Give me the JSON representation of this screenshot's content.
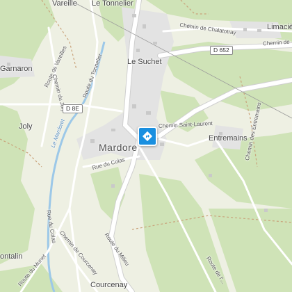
{
  "map": {
    "places": [
      {
        "name": "Vareille"
      },
      {
        "name": "Le Tonnelier"
      },
      {
        "name": "Limaciè"
      },
      {
        "name": "Le Suchet"
      },
      {
        "name": "Garnaron"
      },
      {
        "name": "Joly"
      },
      {
        "name": "Mardore"
      },
      {
        "name": "Entremains"
      },
      {
        "name": "ontalin"
      },
      {
        "name": "Courcenay"
      }
    ],
    "roads": [
      {
        "name": "Chemin de Chalatotray"
      },
      {
        "name": "Chemin de"
      },
      {
        "name": "Route de Vareilles"
      },
      {
        "name": "Route du Tonnelier"
      },
      {
        "name": "Chemin du Joly"
      },
      {
        "name": "Chemin Saint-Laurent"
      },
      {
        "name": "Chemin des Entremains"
      },
      {
        "name": "Rue du Colas"
      },
      {
        "name": "Rue du Colas"
      },
      {
        "name": "Route du Milieu"
      },
      {
        "name": "Chemin de Courcenay"
      },
      {
        "name": "Route du Munet"
      },
      {
        "name": "Route de l'..."
      }
    ],
    "shields": [
      {
        "name": "D 652"
      },
      {
        "name": "D 8E"
      }
    ],
    "river": {
      "name": "Le Mardoret"
    },
    "pin": {
      "icon": "diamond-arrow-icon",
      "color": "#1a8fe0"
    },
    "colors": {
      "forest": "#cfe3b7",
      "meadow": "#eef0e3",
      "road": "#ffffff",
      "road_casing": "#cfcfcf",
      "village": "#e3e3e3",
      "water": "#9cc8e8"
    }
  }
}
